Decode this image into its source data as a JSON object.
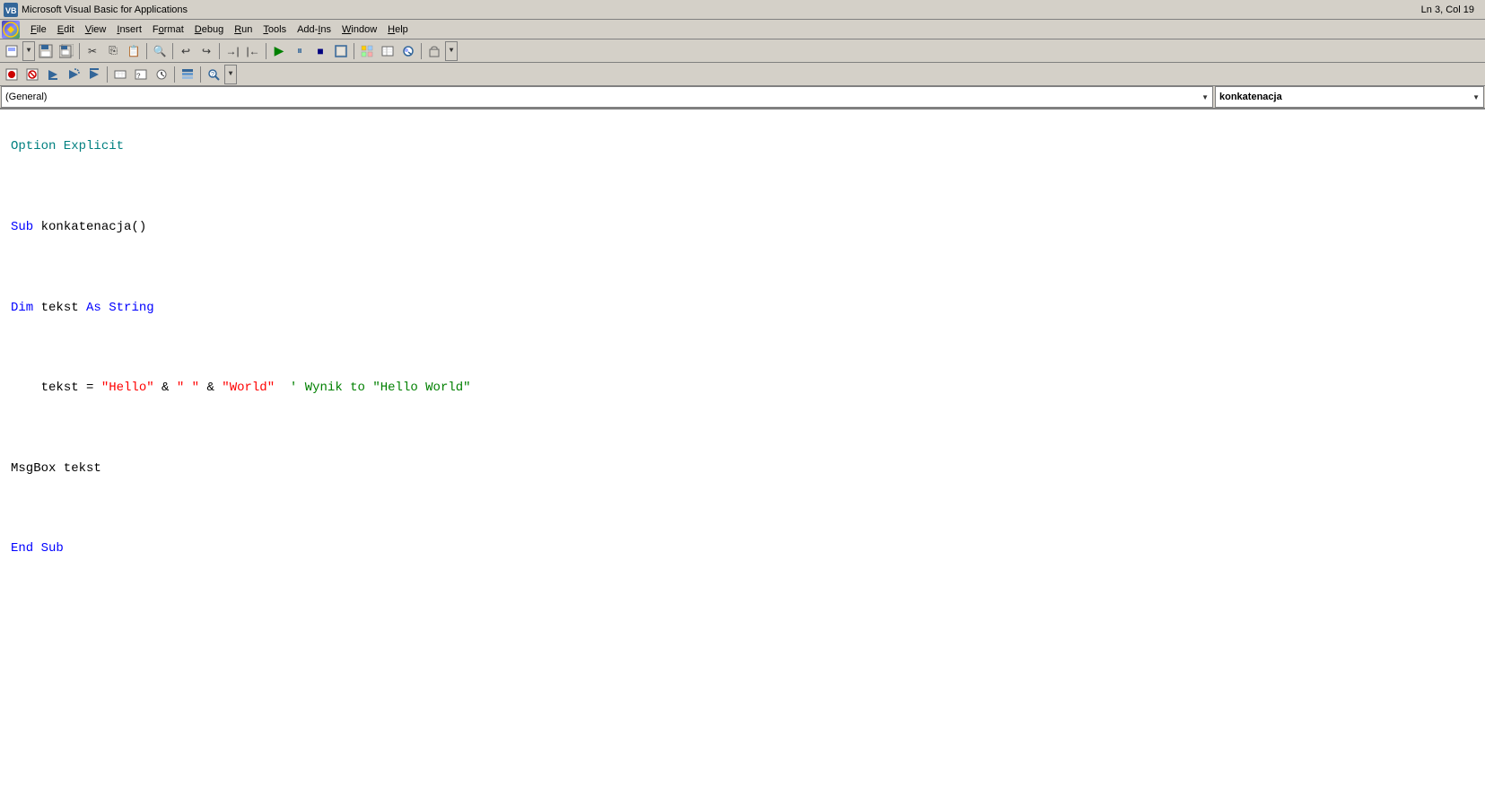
{
  "titlebar": {
    "icon": "VBA",
    "title": "Microsoft Visual Basic for Applications",
    "status": "Ln 3, Col 19"
  },
  "menubar": {
    "logo_text": "VB",
    "items": [
      {
        "label": "File",
        "underline_index": 0
      },
      {
        "label": "Edit",
        "underline_index": 0
      },
      {
        "label": "View",
        "underline_index": 0
      },
      {
        "label": "Insert",
        "underline_index": 0
      },
      {
        "label": "Format",
        "underline_index": 0
      },
      {
        "label": "Debug",
        "underline_index": 0
      },
      {
        "label": "Run",
        "underline_index": 0
      },
      {
        "label": "Tools",
        "underline_index": 0
      },
      {
        "label": "Add-Ins",
        "underline_index": 4
      },
      {
        "label": "Window",
        "underline_index": 0
      },
      {
        "label": "Help",
        "underline_index": 0
      }
    ]
  },
  "dropdowns": {
    "object_label": "(General)",
    "procedure_label": "konkatenacja"
  },
  "code": {
    "lines": [
      {
        "id": 1,
        "type": "option",
        "content": "Option Explicit"
      },
      {
        "id": 2,
        "type": "blank"
      },
      {
        "id": 3,
        "type": "sub_decl",
        "content": "Sub konkatenacja()"
      },
      {
        "id": 4,
        "type": "blank"
      },
      {
        "id": 5,
        "type": "dim",
        "content": "Dim tekst As String"
      },
      {
        "id": 6,
        "type": "blank"
      },
      {
        "id": 7,
        "type": "assignment",
        "content": "    tekst = \"Hello\" & \" \" & \"World\" ' Wynik to \"Hello World\""
      },
      {
        "id": 8,
        "type": "blank"
      },
      {
        "id": 9,
        "type": "msgbox",
        "content": "MsgBox tekst"
      },
      {
        "id": 10,
        "type": "blank"
      },
      {
        "id": 11,
        "type": "end_sub",
        "content": "End Sub"
      }
    ]
  }
}
